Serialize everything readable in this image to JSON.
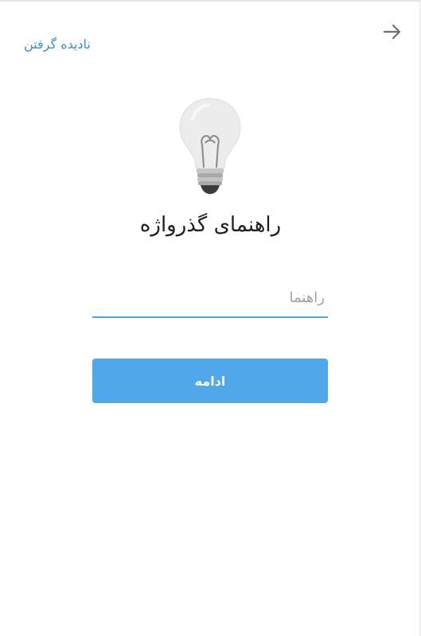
{
  "header": {
    "skip_label": "نادیده گرفتن",
    "back_icon": "arrow-right-icon"
  },
  "main": {
    "illustration_icon": "lightbulb-icon",
    "title": "راهنمای گذرواژه",
    "hint_input": {
      "placeholder": "راهنما",
      "value": ""
    },
    "continue_label": "ادامه"
  },
  "colors": {
    "accent": "#50a7e9",
    "link": "#3d8fcb",
    "underline": "#4aa6e6",
    "title_text": "#1f1f1f",
    "placeholder": "#a3a3a3"
  }
}
